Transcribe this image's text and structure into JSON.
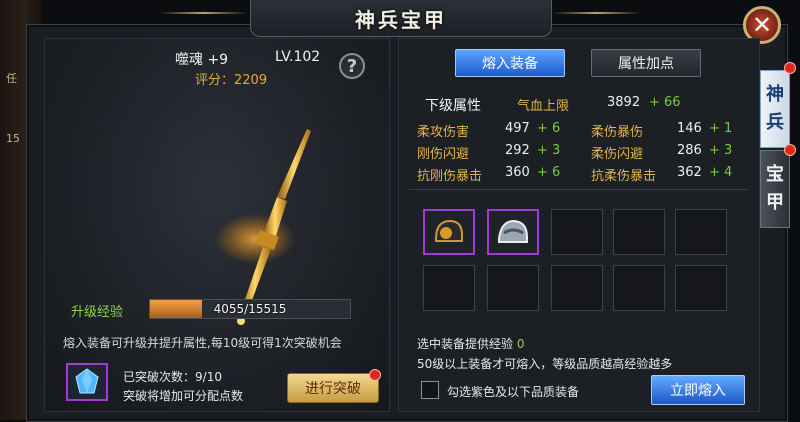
{
  "window": {
    "title": "神兵宝甲",
    "close_icon": "close-icon"
  },
  "left_edge": {
    "mark1": "任",
    "mark2": "15"
  },
  "weapon": {
    "name": "噬魂 +9",
    "level": "LV.102",
    "score_label": "评分：",
    "score_value": "2209",
    "help_label": "?"
  },
  "experience": {
    "label": "升级经验",
    "current": 4055,
    "max": 15515,
    "text": "4055/15515",
    "fill_fraction": 0.2613
  },
  "description": "熔入装备可升级并提升属性,每10级可得1次突破机会",
  "breakthrough": {
    "count_label": "已突破次数：",
    "count_value": "9/10",
    "hint": "突破将增加可分配点数",
    "button_label": "进行突破"
  },
  "tabs": [
    {
      "label": "熔入装备",
      "active": true
    },
    {
      "label": "属性加点",
      "active": false
    }
  ],
  "next_level": {
    "title": "下级属性",
    "hp_label": "气血上限",
    "hp_value": "3892",
    "hp_plus": "+ 66",
    "stats": [
      {
        "label": "柔攻伤害",
        "value": "497",
        "plus": "+ 6"
      },
      {
        "label": "柔伤暴伤",
        "value": "146",
        "plus": "+ 1"
      },
      {
        "label": "刚伤闪避",
        "value": "292",
        "plus": "+ 3"
      },
      {
        "label": "柔伤闪避",
        "value": "286",
        "plus": "+ 3"
      },
      {
        "label": "抗刚伤暴击",
        "value": "360",
        "plus": "+ 6"
      },
      {
        "label": "抗柔伤暴击",
        "value": "362",
        "plus": "+ 4"
      }
    ]
  },
  "equip_slots": [
    {
      "filled": true,
      "icon": "helmet-icon"
    },
    {
      "filled": true,
      "icon": "helmet-icon"
    },
    {
      "filled": false
    },
    {
      "filled": false
    },
    {
      "filled": false
    },
    {
      "filled": false
    },
    {
      "filled": false
    },
    {
      "filled": false
    },
    {
      "filled": false
    },
    {
      "filled": false
    }
  ],
  "bottom": {
    "provide_label": "选中装备提供经验",
    "provide_value": "0",
    "rule": "50级以上装备才可熔入，等级品质越高经验越多",
    "checkbox_label": "勾选紫色及以下品质装备",
    "checkbox_checked": false,
    "smelt_button": "立即熔入"
  },
  "side_tabs": [
    {
      "chars": [
        "神",
        "兵"
      ],
      "active": true
    },
    {
      "chars": [
        "宝",
        "甲"
      ],
      "active": false
    }
  ],
  "colors": {
    "accent_blue": "#1f5bc8",
    "gold": "#e0b34c",
    "green": "#77cc44",
    "purple_frame": "#a23ad6",
    "exp_orange": "#f0a24a"
  }
}
